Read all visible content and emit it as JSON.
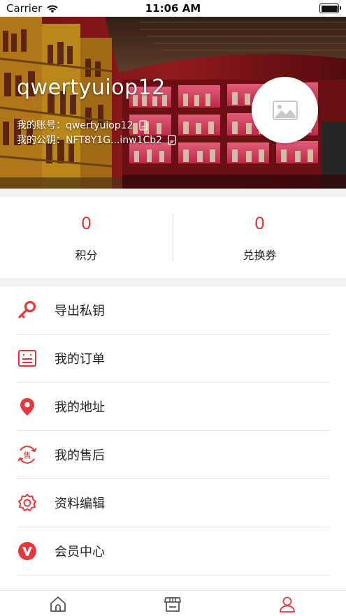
{
  "status_bar": {
    "carrier": "Carrier",
    "time": "11:06 AM"
  },
  "profile": {
    "username": "qwertyuiop12",
    "account_line": "我的账号：qwertyuiop12",
    "public_key_line": "我的公钥：NFT8Y1G...inw1Cb2",
    "avatar_icon": "image-placeholder-icon"
  },
  "stats": {
    "points": {
      "value": "0",
      "label": "积分"
    },
    "vouchers": {
      "value": "0",
      "label": "兑换券"
    }
  },
  "menu": {
    "items": [
      {
        "label": "导出私钥",
        "icon": "key-icon"
      },
      {
        "label": "我的订单",
        "icon": "order-icon"
      },
      {
        "label": "我的地址",
        "icon": "location-pin-icon"
      },
      {
        "label": "我的售后",
        "icon": "after-sale-icon"
      },
      {
        "label": "资料编辑",
        "icon": "settings-gear-icon"
      },
      {
        "label": "会员中心",
        "icon": "vip-icon"
      }
    ]
  },
  "tabbar": {
    "tabs": [
      {
        "name": "home",
        "icon": "home-icon"
      },
      {
        "name": "store",
        "icon": "store-icon"
      },
      {
        "name": "profile",
        "icon": "user-icon",
        "active": true
      }
    ]
  },
  "colors": {
    "accent": "#e5383b",
    "divider": "#e6e6e6",
    "section_gap": "#f2f2f2"
  }
}
